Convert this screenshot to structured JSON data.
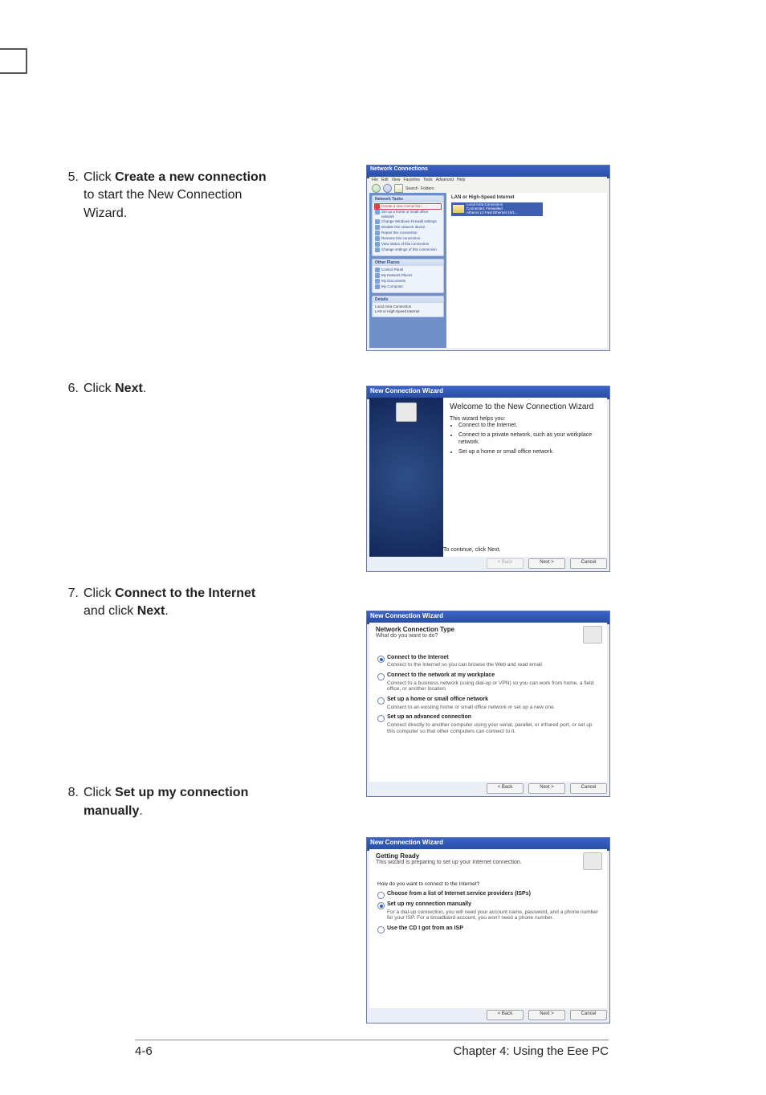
{
  "steps": [
    {
      "num": "5.",
      "pre": "Click ",
      "bold": "Create a new connection",
      "post": " to start the New Connection Wizard."
    },
    {
      "num": "6.",
      "pre": "Click ",
      "bold": "Next",
      "post": "."
    },
    {
      "num": "7.",
      "pre": "Click ",
      "bold": "Connect to the Internet",
      "post": " and click ",
      "bold2": "Next",
      "post2": "."
    },
    {
      "num": "8.",
      "pre": "Click ",
      "bold": "Set up my connection manually",
      "post": "."
    }
  ],
  "fig5": {
    "title": "Network Connections",
    "menu": [
      "File",
      "Edit",
      "View",
      "Favorites",
      "Tools",
      "Advanced",
      "Help"
    ],
    "toolbar": {
      "search": "Search",
      "folders": "Folders"
    },
    "tasks_header": "Network Tasks",
    "tasks": [
      "Create a new connection",
      "Set up a home or small office network",
      "Change Windows Firewall settings",
      "Disable this network device",
      "Repair this connection",
      "Rename this connection",
      "View status of this connection",
      "Change settings of this connection"
    ],
    "places_header": "Other Places",
    "places": [
      "Control Panel",
      "My Network Places",
      "My Documents",
      "My Computer"
    ],
    "details_header": "Details",
    "details": "Local Area Connection\nLAN or High-Speed Internet",
    "main_header": "LAN or High-Speed Internet",
    "conn_line1": "Local Area Connection",
    "conn_line2": "Connected, Firewalled",
    "conn_line3": "Atheros L2 Fast Ethernet 10/1..."
  },
  "fig6": {
    "title": "New Connection Wizard",
    "heading": "Welcome to the New Connection Wizard",
    "intro": "This wizard helps you:",
    "bullets": [
      "Connect to the Internet.",
      "Connect to a private network, such as your workplace network.",
      "Set up a home or small office network."
    ],
    "continue": "To continue, click Next.",
    "back": "< Back",
    "next": "Next >",
    "cancel": "Cancel"
  },
  "fig7": {
    "title": "New Connection Wizard",
    "head_bold": "Network Connection Type",
    "head_sub": "What do you want to do?",
    "options": [
      {
        "b": "Connect to the Internet",
        "d": "Connect to the Internet so you can browse the Web and read email.",
        "on": true
      },
      {
        "b": "Connect to the network at my workplace",
        "d": "Connect to a business network (using dial-up or VPN) so you can work from home, a field office, or another location.",
        "on": false
      },
      {
        "b": "Set up a home or small office network",
        "d": "Connect to an existing home or small office network or set up a new one.",
        "on": false
      },
      {
        "b": "Set up an advanced connection",
        "d": "Connect directly to another computer using your serial, parallel, or infrared port, or set up this computer so that other computers can connect to it.",
        "on": false
      }
    ],
    "back": "< Back",
    "next": "Next >",
    "cancel": "Cancel"
  },
  "fig8": {
    "title": "New Connection Wizard",
    "head_bold": "Getting Ready",
    "head_sub": "This wizard is preparing to set up your Internet connection.",
    "question": "How do you want to connect to the Internet?",
    "options": [
      {
        "b": "Choose from a list of Internet service providers (ISPs)",
        "d": "",
        "on": false
      },
      {
        "b": "Set up my connection manually",
        "d": "For a dial-up connection, you will need your account name, password, and a phone number for your ISP. For a broadband account, you won't need a phone number.",
        "on": true
      },
      {
        "b": "Use the CD I got from an ISP",
        "d": "",
        "on": false
      }
    ],
    "back": "< Back",
    "next": "Next >",
    "cancel": "Cancel"
  },
  "footer": {
    "pageno": "4-6",
    "chapter": "Chapter 4: Using the Eee PC"
  }
}
